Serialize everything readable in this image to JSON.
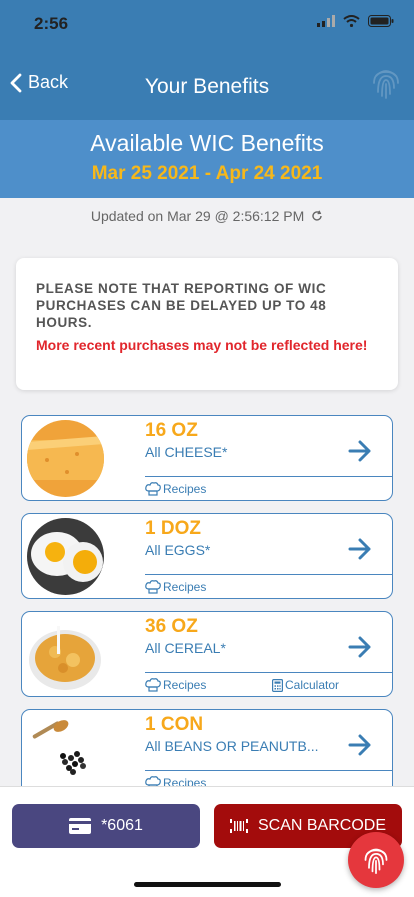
{
  "status": {
    "time": "2:56"
  },
  "nav": {
    "back_label": "Back",
    "title": "Your Benefits"
  },
  "benefits": {
    "heading": "Available WIC Benefits",
    "dates": "Mar 25 2021 - Apr 24 2021",
    "updated": "Updated on Mar 29 @ 2:56:12 PM"
  },
  "notice": {
    "main": "PLEASE NOTE THAT REPORTING OF WIC PURCHASES CAN BE DELAYED UP TO 48 HOURS.",
    "warning": "More recent purchases may not be reflected here!"
  },
  "items": [
    {
      "qty": "16 OZ",
      "name": "All CHEESE*",
      "recipes_label": "Recipes"
    },
    {
      "qty": "1 DOZ",
      "name": "All EGGS*",
      "recipes_label": "Recipes"
    },
    {
      "qty": "36 OZ",
      "name": "All CEREAL*",
      "recipes_label": "Recipes",
      "calculator_label": "Calculator"
    },
    {
      "qty": "1 CON",
      "name": "All BEANS OR PEANUTB...",
      "recipes_label": "Recipes"
    }
  ],
  "bottom": {
    "card_label": "*6061",
    "scan_label": "SCAN BARCODE"
  },
  "colors": {
    "header": "#3a7db3",
    "band": "#4e8fca",
    "accent": "#f7b81a",
    "warning": "#e1262c",
    "card_button": "#4a4780",
    "scan_button": "#a30c0c",
    "fab": "#e5373d"
  },
  "icons": [
    "signal-icon",
    "wifi-icon",
    "battery-icon",
    "chevron-left-icon",
    "fingerprint-icon",
    "refresh-icon",
    "arrow-right-icon",
    "chef-hat-icon",
    "calculator-icon",
    "credit-card-icon",
    "barcode-icon"
  ]
}
